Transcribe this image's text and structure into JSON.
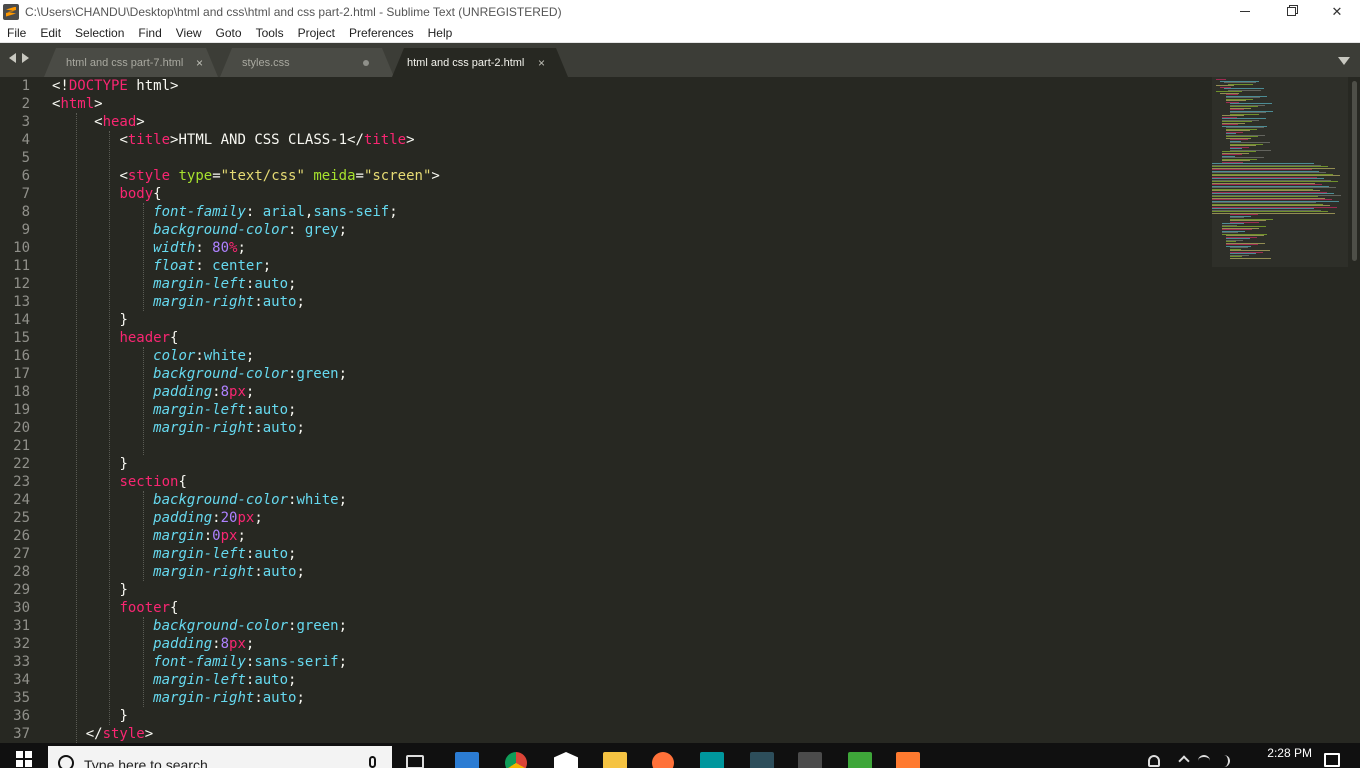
{
  "window": {
    "title": "C:\\Users\\CHANDU\\Desktop\\html and css\\html and css part-2.html - Sublime Text (UNREGISTERED)",
    "minimize_icon": "minimize-icon",
    "maximize_icon": "maximize-icon",
    "close_glyph": "✕"
  },
  "menu": [
    "File",
    "Edit",
    "Selection",
    "Find",
    "View",
    "Goto",
    "Tools",
    "Project",
    "Preferences",
    "Help"
  ],
  "tabs": [
    {
      "label": "html and css part-7.html",
      "close": "×",
      "dirty": false,
      "active": false
    },
    {
      "label": "styles.css",
      "close": "",
      "dirty": true,
      "active": false
    },
    {
      "label": "html and css part-2.html",
      "close": "×",
      "dirty": false,
      "active": true
    }
  ],
  "editor": {
    "lines": [
      {
        "n": "1",
        "indent": 0,
        "tokens": [
          [
            "pl",
            "<!"
          ],
          [
            "tag",
            "DOCTYPE"
          ],
          [
            "pl",
            " html>"
          ]
        ]
      },
      {
        "n": "2",
        "indent": 0,
        "tokens": [
          [
            "pl",
            "<"
          ],
          [
            "tag",
            "html"
          ],
          [
            "pl",
            ">"
          ]
        ]
      },
      {
        "n": "3",
        "indent": 5,
        "tokens": [
          [
            "pl",
            "<"
          ],
          [
            "tag",
            "head"
          ],
          [
            "pl",
            ">"
          ]
        ]
      },
      {
        "n": "4",
        "indent": 8,
        "tokens": [
          [
            "pl",
            "<"
          ],
          [
            "tag",
            "title"
          ],
          [
            "pl",
            ">HTML AND CSS CLASS-1</"
          ],
          [
            "tag",
            "title"
          ],
          [
            "pl",
            ">"
          ]
        ]
      },
      {
        "n": "5",
        "indent": 0,
        "tokens": []
      },
      {
        "n": "6",
        "indent": 8,
        "tokens": [
          [
            "pl",
            "<"
          ],
          [
            "tag",
            "style"
          ],
          [
            "pl",
            " "
          ],
          [
            "attr",
            "type"
          ],
          [
            "pl",
            "="
          ],
          [
            "str",
            "\"text/css\""
          ],
          [
            "pl",
            " "
          ],
          [
            "attr",
            "meida"
          ],
          [
            "pl",
            "="
          ],
          [
            "str",
            "\"screen\""
          ],
          [
            "pl",
            ">"
          ]
        ]
      },
      {
        "n": "7",
        "indent": 8,
        "tokens": [
          [
            "sel",
            "body"
          ],
          [
            "pl",
            "{"
          ]
        ]
      },
      {
        "n": "8",
        "indent": 12,
        "tokens": [
          [
            "prop",
            "font-family"
          ],
          [
            "pl",
            ": "
          ],
          [
            "val",
            "arial"
          ],
          [
            "pl",
            ","
          ],
          [
            "val",
            "sans-seif"
          ],
          [
            "pl",
            ";"
          ]
        ]
      },
      {
        "n": "9",
        "indent": 12,
        "tokens": [
          [
            "prop",
            "background-color"
          ],
          [
            "pl",
            ": "
          ],
          [
            "val",
            "grey"
          ],
          [
            "pl",
            ";"
          ]
        ]
      },
      {
        "n": "10",
        "indent": 12,
        "tokens": [
          [
            "prop",
            "width"
          ],
          [
            "pl",
            ": "
          ],
          [
            "num",
            "80"
          ],
          [
            "unit",
            "%"
          ],
          [
            "pl",
            ";"
          ]
        ]
      },
      {
        "n": "11",
        "indent": 12,
        "tokens": [
          [
            "prop",
            "float"
          ],
          [
            "pl",
            ": "
          ],
          [
            "val",
            "center"
          ],
          [
            "pl",
            ";"
          ]
        ]
      },
      {
        "n": "12",
        "indent": 12,
        "tokens": [
          [
            "prop",
            "margin-left"
          ],
          [
            "pl",
            ":"
          ],
          [
            "val",
            "auto"
          ],
          [
            "pl",
            ";"
          ]
        ]
      },
      {
        "n": "13",
        "indent": 12,
        "tokens": [
          [
            "prop",
            "margin-right"
          ],
          [
            "pl",
            ":"
          ],
          [
            "val",
            "auto"
          ],
          [
            "pl",
            ";"
          ]
        ]
      },
      {
        "n": "14",
        "indent": 8,
        "tokens": [
          [
            "pl",
            "}"
          ]
        ]
      },
      {
        "n": "15",
        "indent": 8,
        "tokens": [
          [
            "sel",
            "header"
          ],
          [
            "pl",
            "{"
          ]
        ]
      },
      {
        "n": "16",
        "indent": 12,
        "tokens": [
          [
            "prop",
            "color"
          ],
          [
            "pl",
            ":"
          ],
          [
            "val",
            "white"
          ],
          [
            "pl",
            ";"
          ]
        ]
      },
      {
        "n": "17",
        "indent": 12,
        "tokens": [
          [
            "prop",
            "background-color"
          ],
          [
            "pl",
            ":"
          ],
          [
            "val",
            "green"
          ],
          [
            "pl",
            ";"
          ]
        ]
      },
      {
        "n": "18",
        "indent": 12,
        "tokens": [
          [
            "prop",
            "padding"
          ],
          [
            "pl",
            ":"
          ],
          [
            "num",
            "8"
          ],
          [
            "unit",
            "px"
          ],
          [
            "pl",
            ";"
          ]
        ]
      },
      {
        "n": "19",
        "indent": 12,
        "tokens": [
          [
            "prop",
            "margin-left"
          ],
          [
            "pl",
            ":"
          ],
          [
            "val",
            "auto"
          ],
          [
            "pl",
            ";"
          ]
        ]
      },
      {
        "n": "20",
        "indent": 12,
        "tokens": [
          [
            "prop",
            "margin-right"
          ],
          [
            "pl",
            ":"
          ],
          [
            "val",
            "auto"
          ],
          [
            "pl",
            ";"
          ]
        ]
      },
      {
        "n": "21",
        "indent": 0,
        "tokens": []
      },
      {
        "n": "22",
        "indent": 8,
        "tokens": [
          [
            "pl",
            "}"
          ]
        ]
      },
      {
        "n": "23",
        "indent": 8,
        "tokens": [
          [
            "sel",
            "section"
          ],
          [
            "pl",
            "{"
          ]
        ]
      },
      {
        "n": "24",
        "indent": 12,
        "tokens": [
          [
            "prop",
            "background-color"
          ],
          [
            "pl",
            ":"
          ],
          [
            "val",
            "white"
          ],
          [
            "pl",
            ";"
          ]
        ]
      },
      {
        "n": "25",
        "indent": 12,
        "tokens": [
          [
            "prop",
            "padding"
          ],
          [
            "pl",
            ":"
          ],
          [
            "num",
            "20"
          ],
          [
            "unit",
            "px"
          ],
          [
            "pl",
            ";"
          ]
        ]
      },
      {
        "n": "26",
        "indent": 12,
        "tokens": [
          [
            "prop",
            "margin"
          ],
          [
            "pl",
            ":"
          ],
          [
            "num",
            "0"
          ],
          [
            "unit",
            "px"
          ],
          [
            "pl",
            ";"
          ]
        ]
      },
      {
        "n": "27",
        "indent": 12,
        "tokens": [
          [
            "prop",
            "margin-left"
          ],
          [
            "pl",
            ":"
          ],
          [
            "val",
            "auto"
          ],
          [
            "pl",
            ";"
          ]
        ]
      },
      {
        "n": "28",
        "indent": 12,
        "tokens": [
          [
            "prop",
            "margin-right"
          ],
          [
            "pl",
            ":"
          ],
          [
            "val",
            "auto"
          ],
          [
            "pl",
            ";"
          ]
        ]
      },
      {
        "n": "29",
        "indent": 8,
        "tokens": [
          [
            "pl",
            "}"
          ]
        ]
      },
      {
        "n": "30",
        "indent": 8,
        "tokens": [
          [
            "sel",
            "footer"
          ],
          [
            "pl",
            "{"
          ]
        ]
      },
      {
        "n": "31",
        "indent": 12,
        "tokens": [
          [
            "prop",
            "background-color"
          ],
          [
            "pl",
            ":"
          ],
          [
            "val",
            "green"
          ],
          [
            "pl",
            ";"
          ]
        ]
      },
      {
        "n": "32",
        "indent": 12,
        "tokens": [
          [
            "prop",
            "padding"
          ],
          [
            "pl",
            ":"
          ],
          [
            "num",
            "8"
          ],
          [
            "unit",
            "px"
          ],
          [
            "pl",
            ";"
          ]
        ]
      },
      {
        "n": "33",
        "indent": 12,
        "tokens": [
          [
            "prop",
            "font-family"
          ],
          [
            "pl",
            ":"
          ],
          [
            "val",
            "sans-serif"
          ],
          [
            "pl",
            ";"
          ]
        ]
      },
      {
        "n": "34",
        "indent": 12,
        "tokens": [
          [
            "prop",
            "margin-left"
          ],
          [
            "pl",
            ":"
          ],
          [
            "val",
            "auto"
          ],
          [
            "pl",
            ";"
          ]
        ]
      },
      {
        "n": "35",
        "indent": 12,
        "tokens": [
          [
            "prop",
            "margin-right"
          ],
          [
            "pl",
            ":"
          ],
          [
            "val",
            "auto"
          ],
          [
            "pl",
            ";"
          ]
        ]
      },
      {
        "n": "36",
        "indent": 8,
        "tokens": [
          [
            "pl",
            "}"
          ]
        ]
      },
      {
        "n": "37",
        "indent": 4,
        "tokens": [
          [
            "pl",
            "</"
          ],
          [
            "tag",
            "style"
          ],
          [
            "pl",
            ">"
          ]
        ]
      }
    ]
  },
  "taskbar": {
    "search_placeholder": "Type here to search",
    "apps": [
      {
        "name": "task-view-icon",
        "color": "#101010"
      },
      {
        "name": "store-icon",
        "color": "#2b7cd3"
      },
      {
        "name": "chrome-icon",
        "color": "#4285f4"
      },
      {
        "name": "mail-icon",
        "color": "#ffffff"
      },
      {
        "name": "file-explorer-icon",
        "color": "#f5c342"
      },
      {
        "name": "firefox-icon",
        "color": "#ff7139"
      },
      {
        "name": "arduino-icon",
        "color": "#00979d"
      },
      {
        "name": "app-icon",
        "color": "#2d4e5b"
      },
      {
        "name": "sublime-text-icon",
        "color": "#4b4b4b"
      },
      {
        "name": "camtasia-icon",
        "color": "#3ea639"
      },
      {
        "name": "app-icon",
        "color": "#ff7a2f"
      }
    ],
    "time": "2:28 PM"
  }
}
